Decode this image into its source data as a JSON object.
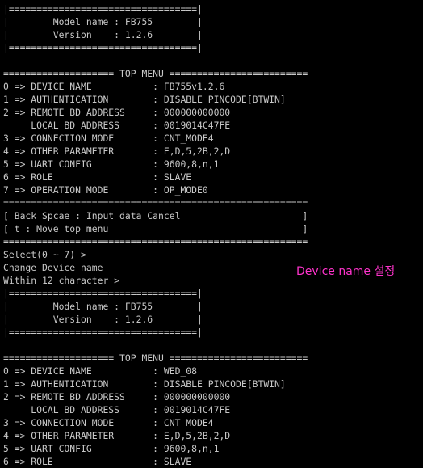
{
  "colors": {
    "background": "#000000",
    "terminal_text": "#c8c8c8",
    "annotation": "#ff33cc"
  },
  "annotation": "Device name 설정",
  "lines": [
    "|==================================|",
    "|        Model name : FB755        |",
    "|        Version    : 1.2.6        |",
    "|==================================|",
    "",
    "==================== TOP MENU =========================",
    "0 => DEVICE NAME           : FB755v1.2.6",
    "1 => AUTHENTICATION        : DISABLE PINCODE[BTWIN]",
    "2 => REMOTE BD ADDRESS     : 000000000000",
    "     LOCAL BD ADDRESS      : 0019014C47FE",
    "3 => CONNECTION MODE       : CNT_MODE4",
    "4 => OTHER PARAMETER       : E,D,5,2B,2,D",
    "5 => UART CONFIG           : 9600,8,n,1",
    "6 => ROLE                  : SLAVE",
    "7 => OPERATION MODE        : OP_MODE0",
    "=======================================================",
    "[ Back Spcae : Input data Cancel                      ]",
    "[ t : Move top menu                                   ]",
    "=======================================================",
    "Select(0 ~ 7) >",
    "Change Device name",
    "Within 12 character >",
    "|==================================|",
    "|        Model name : FB755        |",
    "|        Version    : 1.2.6        |",
    "|==================================|",
    "",
    "==================== TOP MENU =========================",
    "0 => DEVICE NAME           : WED_08",
    "1 => AUTHENTICATION        : DISABLE PINCODE[BTWIN]",
    "2 => REMOTE BD ADDRESS     : 000000000000",
    "     LOCAL BD ADDRESS      : 0019014C47FE",
    "3 => CONNECTION MODE       : CNT_MODE4",
    "4 => OTHER PARAMETER       : E,D,5,2B,2,D",
    "5 => UART CONFIG           : 9600,8,n,1",
    "6 => ROLE                  : SLAVE"
  ]
}
